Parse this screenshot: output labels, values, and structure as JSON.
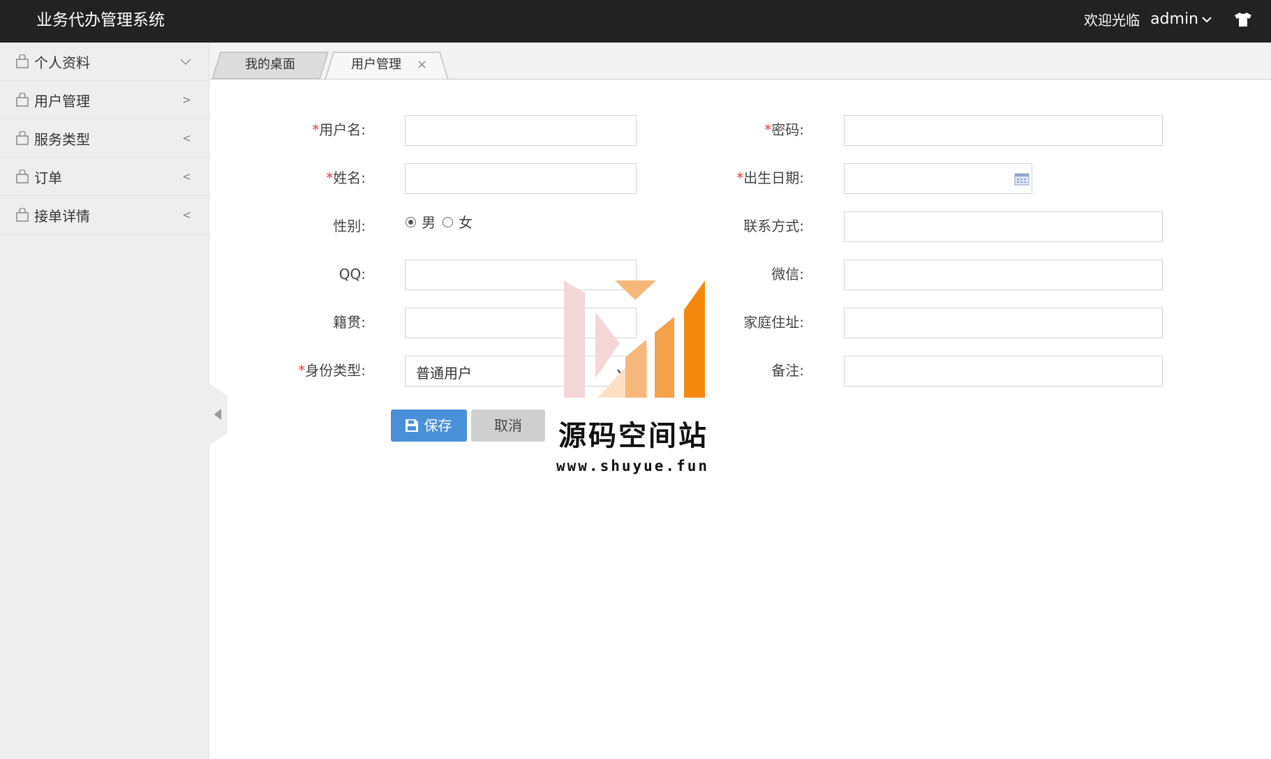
{
  "app": {
    "title": "业务代办管理系统",
    "welcome": "欢迎光临",
    "user": "admin",
    "icons": {
      "user_menu": "chevron-down-icon",
      "theme": "tshirt-icon"
    }
  },
  "sidebar": {
    "items": [
      {
        "label": "个人资料",
        "icon": "bag-icon",
        "arrow": "chevron-down"
      },
      {
        "label": "用户管理",
        "icon": "bag-icon",
        "arrow": ">"
      },
      {
        "label": "服务类型",
        "icon": "bag-icon",
        "arrow": "<"
      },
      {
        "label": "订单",
        "icon": "bag-icon",
        "arrow": "<"
      },
      {
        "label": "接单详情",
        "icon": "bag-icon",
        "arrow": "<"
      }
    ]
  },
  "tabs": [
    {
      "label": "我的桌面",
      "active": false
    },
    {
      "label": "用户管理",
      "active": true,
      "close": "×"
    }
  ],
  "form": {
    "required_mark": "*",
    "username": {
      "label": "用户名:",
      "value": ""
    },
    "password": {
      "label": "密码:",
      "value": ""
    },
    "name": {
      "label": "姓名:",
      "value": ""
    },
    "birthdate": {
      "label": "出生日期:",
      "value": ""
    },
    "gender": {
      "label": "性别:",
      "options": [
        "男",
        "女"
      ],
      "selected": "男"
    },
    "contact": {
      "label": "联系方式:",
      "value": ""
    },
    "qq": {
      "label": "QQ:",
      "value": ""
    },
    "wechat": {
      "label": "微信:",
      "value": ""
    },
    "native_place": {
      "label": "籍贯:",
      "value": ""
    },
    "address": {
      "label": "家庭住址:",
      "value": ""
    },
    "identity_type": {
      "label": "身份类型:",
      "value": "普通用户"
    },
    "remarks": {
      "label": "备注:",
      "value": ""
    },
    "save_label": "保存",
    "cancel_label": "取消"
  },
  "watermark": {
    "title": "源码空间站",
    "url": "www.shuyue.fun",
    "colors": {
      "orange": "#f5890d",
      "light_orange": "#f8b77a",
      "pink": "#f4d6d6"
    }
  },
  "colors": {
    "topbar": "#222222",
    "sidebar": "#eeeeee",
    "primary_button": "#4a90d9",
    "required": "#e53935"
  }
}
